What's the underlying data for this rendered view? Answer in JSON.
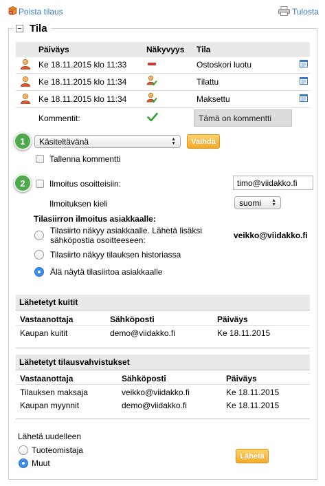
{
  "top": {
    "delete_label": "Poista tilaus",
    "print_label": "Tulosta"
  },
  "section": {
    "title": "Tila"
  },
  "history": {
    "headers": [
      "Päiväys",
      "Näkyvyys",
      "Tila"
    ],
    "rows": [
      {
        "date": "Ke 18.11.2015 klo 11:33",
        "visibility": "hidden",
        "status": "Ostoskori luotu"
      },
      {
        "date": "Ke 18.11.2015 klo 11:34",
        "visibility": "visible",
        "status": "Tilattu"
      },
      {
        "date": "Ke 18.11.2015 klo 11:34",
        "visibility": "visible",
        "status": "Maksettu"
      }
    ],
    "comment_label": "Kommentit:",
    "comment_text": "Tämä on kommentti"
  },
  "status_form": {
    "badge1": "1",
    "badge2": "2",
    "status_select": "Käsiteltävänä",
    "change_button": "Vaihda",
    "save_comment_label": "Tallenna kommentti",
    "notify_label": "Ilmoitus osoitteisiin:",
    "notify_email": "timo@viidakko.fi",
    "language_label": "Ilmoituksen kieli",
    "language_select": "suomi",
    "customer_notice_title": "Tilasiirron ilmoitus asiakkaalle:",
    "option1_line1": "Tilasiirto näkyy asiakkaalle. Lähetä lisäksi",
    "option1_line2": "sähköpostia osoitteeseen:",
    "option1_email": "veikko@viidakko.fi",
    "option2": "Tilasiirto näkyy tilauksen historiassa",
    "option3": "Älä näytä tilasiirtoa asiakkaalle",
    "selected_option": 3
  },
  "receipts": {
    "title": "Lähetetyt kuitit",
    "headers": [
      "Vastaanottaja",
      "Sähköposti",
      "Päiväys"
    ],
    "rows": [
      {
        "recipient": "Kaupan kuitit",
        "email": "demo@viidakko.fi",
        "date": "Ke 18.11.2015"
      }
    ]
  },
  "confirmations": {
    "title": "Lähetetyt tilausvahvistukset",
    "headers": [
      "Vastaanottaja",
      "Sähköposti",
      "Päiväys"
    ],
    "rows": [
      {
        "recipient": "Tilauksen maksaja",
        "email": "veikko@viidakko.fi",
        "date": "Ke 18.11.2015"
      },
      {
        "recipient": "Kaupan myynnit",
        "email": "demo@viidakko.fi",
        "date": "Ke 18.11.2015"
      }
    ]
  },
  "resend": {
    "title": "Lähetä uudelleen",
    "option1": "Tuoteomistaja",
    "option2": "Muut",
    "selected_option": 2,
    "send_button": "Lähetä"
  },
  "colors": {
    "link": "#3a7bc8",
    "badge": "#4ea84d",
    "button": "#f3a928",
    "radio_selected": "#3b8de8",
    "header_bg": "#e9e9e9"
  }
}
